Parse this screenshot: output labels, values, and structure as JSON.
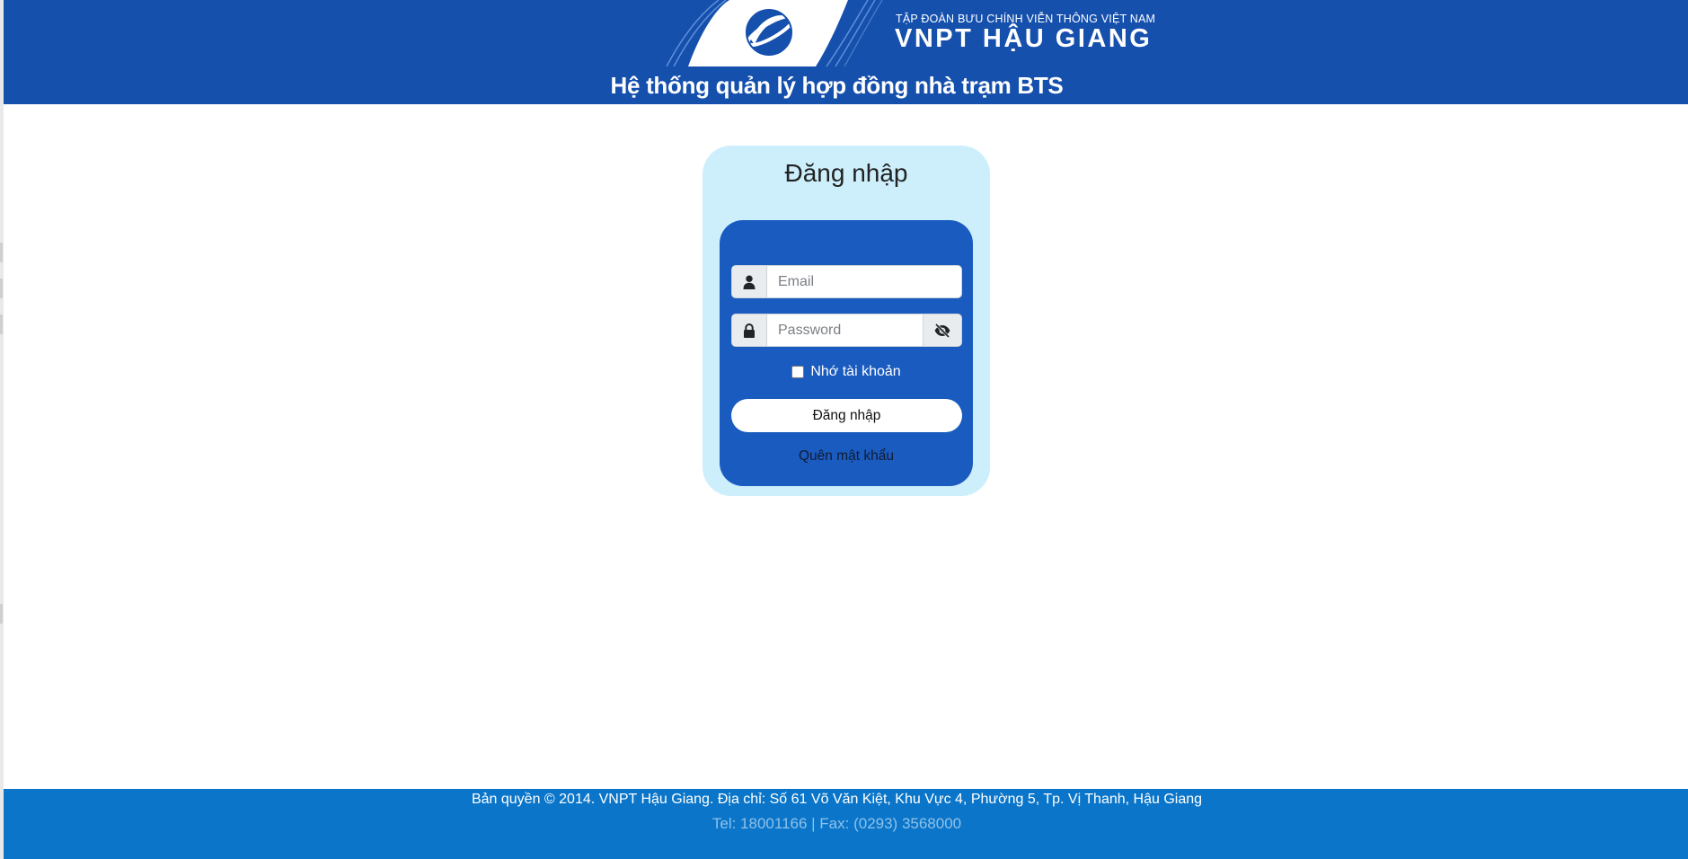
{
  "header": {
    "brand_sub": "TẬP ĐOÀN BƯU CHÍNH VIỄN THÔNG VIỆT NAM",
    "brand_main": "VNPT HẬU GIANG",
    "system_title": "Hệ thống quản lý hợp đồng nhà trạm BTS"
  },
  "login": {
    "title": "Đăng nhập",
    "email_placeholder": "Email",
    "email_value": "",
    "password_placeholder": "Password",
    "password_value": "",
    "remember_label": "Nhớ tài khoản",
    "remember_checked": false,
    "submit_label": "Đăng nhập",
    "forgot_label": "Quên mật khẩu"
  },
  "footer": {
    "copyright": "Bản quyền © 2014. VNPT Hậu Giang. Địa chỉ: Số 61 Võ Văn Kiệt, Khu Vực 4, Phường 5, Tp. Vị Thanh, Hậu Giang",
    "contact": "Tel: 18001166 | Fax: (0293) 3568000"
  },
  "icons": {
    "email_addon": "user-icon",
    "password_addon": "lock-icon",
    "password_toggle": "eye-slash-icon",
    "brand_logo": "vnpt-logo-icon"
  },
  "colors": {
    "header_bg": "#1550ad",
    "card_outer_bg": "#cdeffc",
    "card_inner_bg": "#1a5bbf",
    "footer_bg": "#0b76c9"
  }
}
